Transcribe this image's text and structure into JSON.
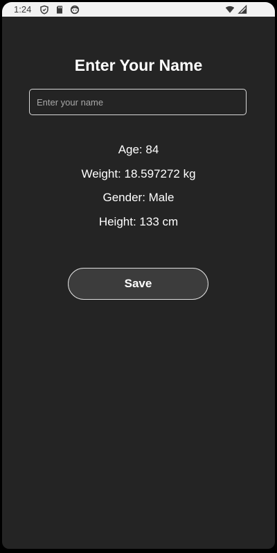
{
  "status_bar": {
    "time": "1:24",
    "left_icons": [
      "shield-icon",
      "sd-card-icon",
      "face-icon"
    ],
    "right_icons": [
      "wifi-icon",
      "signal-icon"
    ]
  },
  "page": {
    "title": "Enter Your Name"
  },
  "name_field": {
    "value": "",
    "placeholder": "Enter your name"
  },
  "info": {
    "age": "Age: 84",
    "weight": "Weight: 18.597272 kg",
    "gender": "Gender: Male",
    "height": "Height: 133 cm"
  },
  "actions": {
    "save_label": "Save"
  },
  "colors": {
    "background": "#242424",
    "status_bar": "#f2f2f2",
    "text": "#ffffff",
    "button_fill": "#3c3c3c",
    "border": "#e0e0e0"
  }
}
